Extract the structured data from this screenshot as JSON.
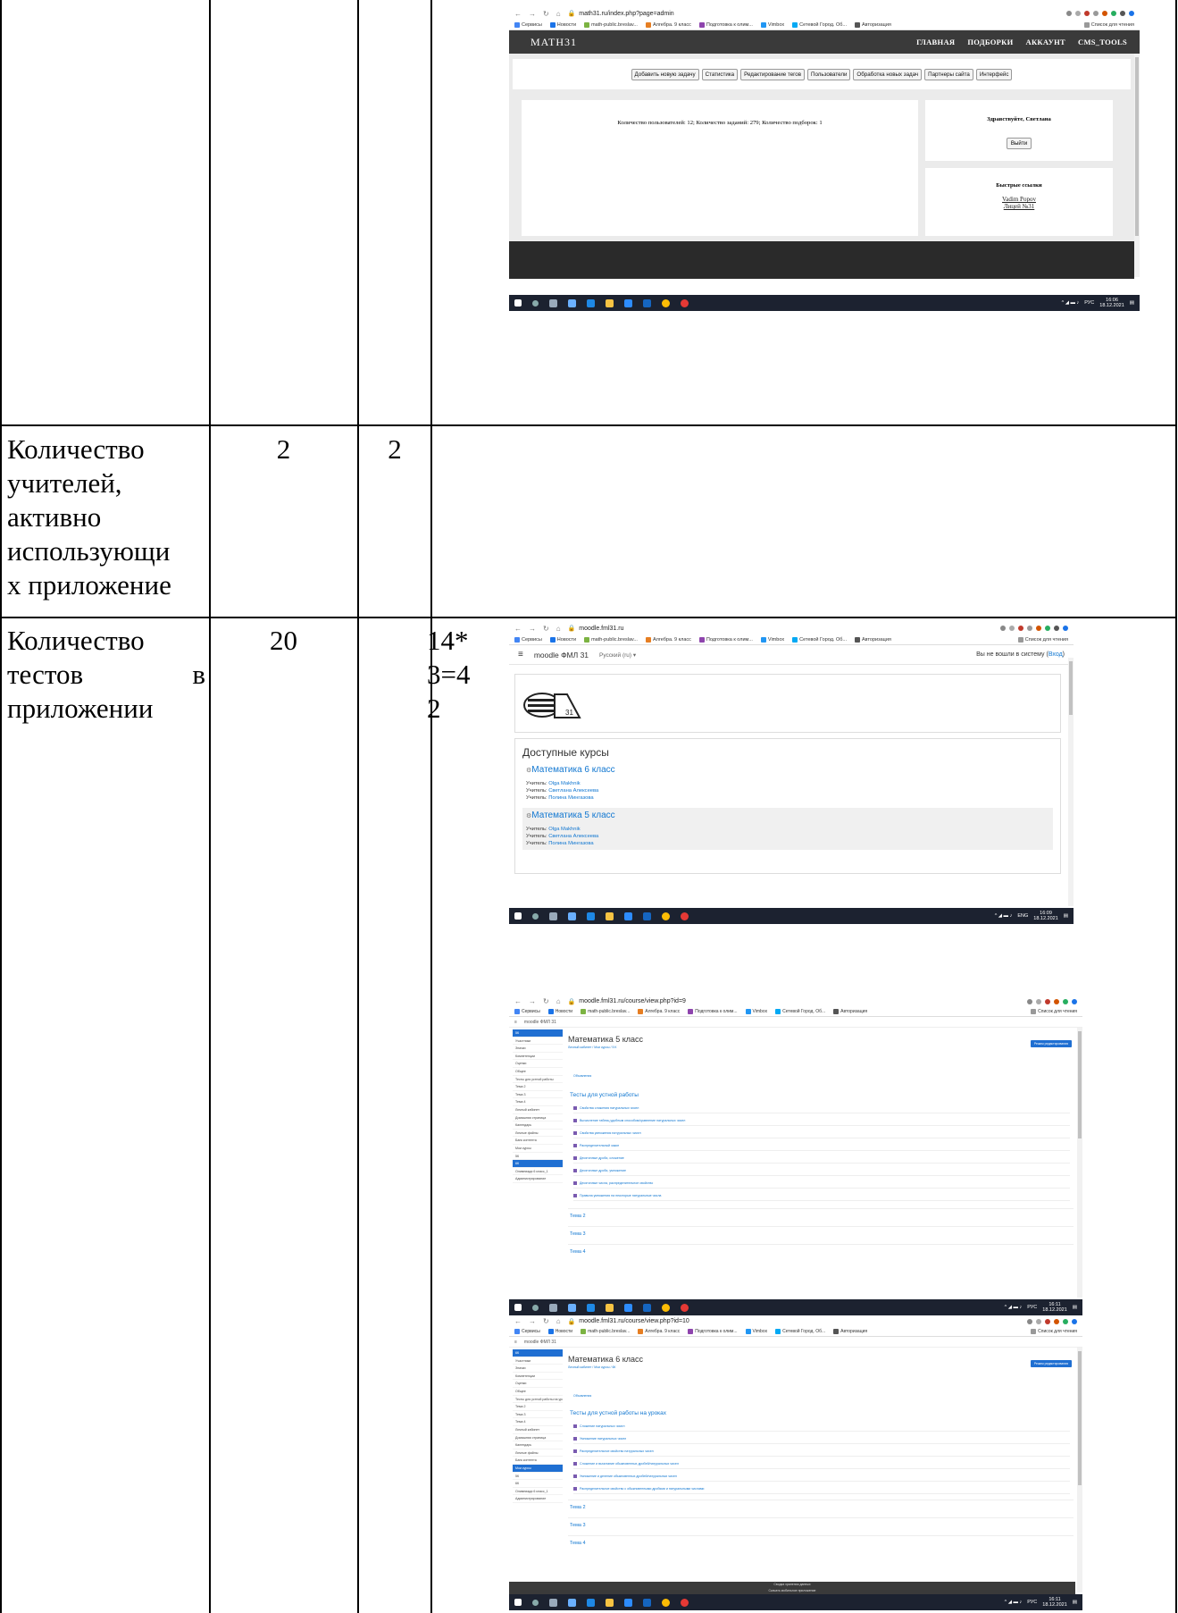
{
  "rows": [
    {
      "label": "",
      "col2": "",
      "col3": ""
    },
    {
      "label": "Количество учителей, активно использующи х приложение",
      "label_lines": [
        "Количество",
        "учителей,",
        "активно",
        "использующи",
        "х приложение"
      ],
      "col2": "2",
      "col3": "2"
    },
    {
      "label_lines": [
        "Количество",
        "тестов",
        "в",
        "приложении"
      ],
      "col2": "20",
      "col3_lines": [
        "14*",
        "3=4",
        "2"
      ]
    }
  ],
  "shot_math31": {
    "url": "math31.ru/index.php?page=admin",
    "bookmarks": [
      "Сервисы",
      "Новости",
      "math-public.breslav...",
      "Алгебра. 9 класс",
      "Подготовка к олим...",
      "Vimbox",
      "Сетевой Город. Об...",
      "Авторизация"
    ],
    "reading_list": "Список для чтения",
    "logo": "MATH31",
    "nav": [
      "ГЛАВНАЯ",
      "ПОДБОРКИ",
      "АККАУНТ",
      "CMS_TOOLS"
    ],
    "toolbar": [
      "Добавить новую задачу",
      "Статистика",
      "Редактирование тегов",
      "Пользователи",
      "Обработка новых задач",
      "Партнеры сайта",
      "Интерфейс"
    ],
    "stats": "Количество пользователей: 12;  Количество заданий: 279;  Количество подборок: 1",
    "hello": "Здравствуйте, Светлана",
    "logout": "Выйти",
    "quick_title": "Быстрые ссылки",
    "quick_links": [
      "Vadim Popov",
      "Лицей №31"
    ],
    "tray_lang": "РУС",
    "time": "16:06",
    "date": "18.12.2021"
  },
  "shot_moodle_home": {
    "url": "moodle.fml31.ru",
    "bookmarks": [
      "Сервисы",
      "Новости",
      "math-public.breslav...",
      "Алгебра. 9 класс",
      "Подготовка к олим...",
      "Vimbox",
      "Сетевой Город. Об...",
      "Авторизация"
    ],
    "reading_list": "Список для чтения",
    "site": "moodle ФМЛ 31",
    "lang": "Русский (ru) ▾",
    "login_prefix": "Вы не вошли в систему (",
    "login_link": "Вход",
    "login_suffix": ")",
    "courses_heading": "Доступные курсы",
    "courses": [
      {
        "title": "Математика 6 класс",
        "teachers": [
          "Olga Makhnik",
          "Светлана Алексеева",
          "Полина Мингазова"
        ]
      },
      {
        "title": "Математика 5 класс",
        "teachers": [
          "Olga Makhnik",
          "Светлана Алексеева",
          "Полина Мингазова"
        ]
      }
    ],
    "teacher_label": "Учитель:",
    "tray_lang": "ENG",
    "time": "16:09",
    "date": "18.12.2021"
  },
  "shot_course5": {
    "url": "moodle.fml31.ru/course/view.php?id=9",
    "site": "moodle ФМЛ 31",
    "title": "Математика 5 класс",
    "breadcrumb": "Личный кабинет  /  Мои курсы  /  5 К",
    "edit_button": "Режим редактирования",
    "announcements": "Объявления",
    "section": "Тесты для устной работы",
    "items": [
      "Свойства сложения натуральных чисел",
      "Вычисление таблиц удобным способом/сравнение натуральных чисел",
      "Свойства умножения натуральных чисел",
      "Распределительный закон",
      "Десятичные дроби, сложение",
      "Десятичные дроби, умножение",
      "Десятичные числа, распределительное свойство",
      "Правила умножения на некоторые натуральные числа"
    ],
    "topics": [
      "Тема 2",
      "Тема 3",
      "Тема 4"
    ],
    "sidebar": [
      "5К",
      "Участники",
      "Значки",
      "Компетенции",
      "Оценки",
      "Общее",
      "Тесты для устной работы",
      "Тема 2",
      "Тема 3",
      "Тема 4",
      "Личный кабинет",
      "Домашняя страница",
      "Календарь",
      "Личные файлы",
      "Банк контента",
      "Мои курсы",
      "5К",
      "6К",
      "Олимпиада 6 класс_1",
      "Администрирование"
    ],
    "tray_lang": "РУС",
    "time": "16:11",
    "date": "18.12.2021"
  },
  "shot_course6": {
    "url": "moodle.fml31.ru/course/view.php?id=10",
    "site": "moodle ФМЛ 31",
    "title": "Математика 6 класс",
    "breadcrumb": "Личный кабинет  /  Мои курсы  /  6К",
    "edit_button": "Режим редактирования",
    "announcements": "Объявления",
    "section": "Тесты для устной работы на уроках",
    "items": [
      "Сложение натуральных чисел",
      "Умножение натуральных чисел",
      "Распределительное свойство натуральных чисел",
      "Сложение и вычитание обыкновенных дробей/натуральных чисел",
      "Умножение и деление обыкновенных дробей/натуральных чисел",
      "Распределительное свойство с обыкновенными дробями и натуральными числами"
    ],
    "topics": [
      "Тема 2",
      "Тема 3",
      "Тема 4"
    ],
    "sidebar": [
      "6К",
      "Участники",
      "Значки",
      "Компетенции",
      "Оценки",
      "Общее",
      "Тесты для устной работы на уроках",
      "Тема 2",
      "Тема 3",
      "Тема 4",
      "Личный кабинет",
      "Домашняя страница",
      "Календарь",
      "Личные файлы",
      "Банк контента",
      "Мои курсы",
      "5К",
      "6К",
      "Олимпиада 6 класс_1",
      "Администрирование"
    ],
    "footer": [
      "Сводка хранения данных",
      "Скачать мобильное приложение"
    ],
    "tray_lang": "РУС",
    "time": "16:11",
    "date": "18.12.2021"
  }
}
